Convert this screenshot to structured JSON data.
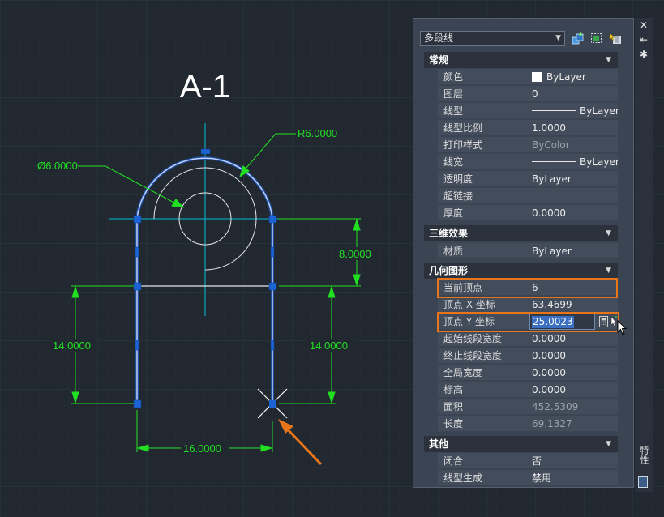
{
  "drawing": {
    "title": "A-1",
    "dimensions": {
      "radius": "R6.0000",
      "diameter": "Ø6.0000",
      "right_upper": "8.0000",
      "left_height": "14.0000",
      "right_height": "14.0000",
      "bottom_width": "16.0000"
    }
  },
  "palette": {
    "object_type": "多段线",
    "tool_icons": [
      "quick-select-icon",
      "select-objects-icon",
      "toggle-pickadd-icon"
    ],
    "side_strip": {
      "close": "✕",
      "pin": "⇤",
      "options": "✱",
      "label": "特性"
    },
    "sections": {
      "general": {
        "title": "常规",
        "rows": [
          {
            "label": "颜色",
            "value": "ByLayer"
          },
          {
            "label": "图层",
            "value": "0"
          },
          {
            "label": "线型",
            "value": "ByLayer"
          },
          {
            "label": "线型比例",
            "value": "1.0000"
          },
          {
            "label": "打印样式",
            "value": "ByColor"
          },
          {
            "label": "线宽",
            "value": "ByLayer"
          },
          {
            "label": "透明度",
            "value": "ByLayer"
          },
          {
            "label": "超链接",
            "value": ""
          },
          {
            "label": "厚度",
            "value": "0.0000"
          }
        ]
      },
      "3d": {
        "title": "三维效果",
        "rows": [
          {
            "label": "材质",
            "value": "ByLayer"
          }
        ]
      },
      "geometry": {
        "title": "几何图形",
        "rows": [
          {
            "label": "当前顶点",
            "value": "6"
          },
          {
            "label": "顶点 X 坐标",
            "value": "63.4699"
          },
          {
            "label": "顶点 Y 坐标",
            "value": "25.0023"
          },
          {
            "label": "起始线段宽度",
            "value": "0.0000"
          },
          {
            "label": "终止线段宽度",
            "value": "0.0000"
          },
          {
            "label": "全局宽度",
            "value": "0.0000"
          },
          {
            "label": "标高",
            "value": "0.0000"
          },
          {
            "label": "面积",
            "value": "452.5309"
          },
          {
            "label": "长度",
            "value": "69.1327"
          }
        ]
      },
      "misc": {
        "title": "其他",
        "rows": [
          {
            "label": "闭合",
            "value": "否"
          },
          {
            "label": "线型生成",
            "value": "禁用"
          }
        ]
      }
    }
  },
  "colors": {
    "background": "#212830",
    "dimension": "#21e021",
    "polyline": "#9fb4ff",
    "grip": "#1c64d6",
    "centerline": "#00bcd4",
    "highlight": "#e8751a"
  }
}
